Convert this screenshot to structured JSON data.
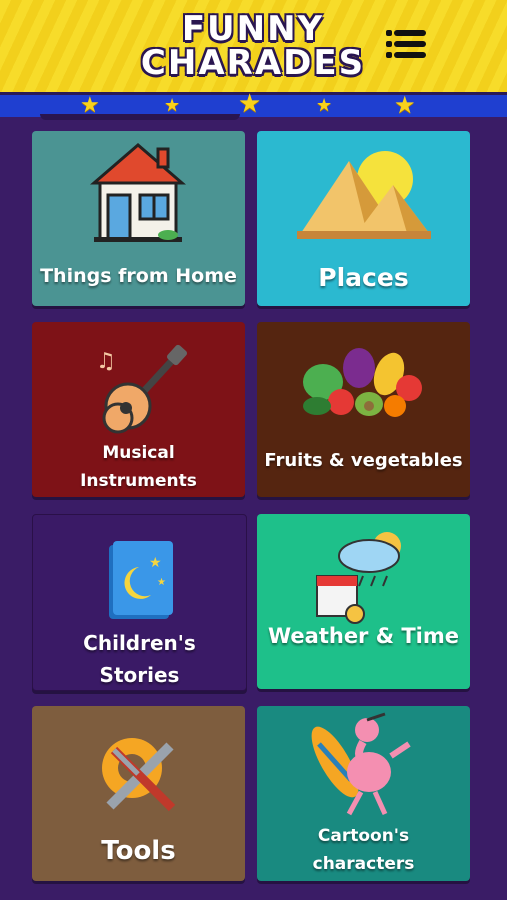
{
  "app": {
    "title_line1": "FUNNY",
    "title_line2": "CHARADES"
  },
  "menu": {
    "icon": "hamburger-menu-icon"
  },
  "colors": {
    "background": "#3a1c66",
    "header_yellow": "#f7dc2a",
    "stripe_blue": "#1f3fd0",
    "star": "#f9d21b"
  },
  "categories": [
    {
      "label": "Things from Home",
      "color": "#4b9493",
      "icon": "house-icon"
    },
    {
      "label": "Places",
      "color": "#2bb9d0",
      "icon": "pyramids-icon"
    },
    {
      "label_line1": "Musical",
      "label_line2": "Instruments",
      "color": "#7e1217",
      "icon": "guitar-icon"
    },
    {
      "label": "Fruits & vegetables",
      "color": "#552510",
      "icon": "fruits-vegetables-icon"
    },
    {
      "label_line1": "Children's",
      "label_line2": "Stories",
      "color": "#3a1a66",
      "icon": "storybook-icon"
    },
    {
      "label": "Weather & Time",
      "color": "#1ec08a",
      "icon": "weather-calendar-icon"
    },
    {
      "label": "Tools",
      "color": "#7e5d3e",
      "icon": "tools-icon"
    },
    {
      "label_line1": "Cartoon's",
      "label_line2": "characters",
      "color": "#198a80",
      "icon": "flamingo-surfer-icon"
    }
  ]
}
